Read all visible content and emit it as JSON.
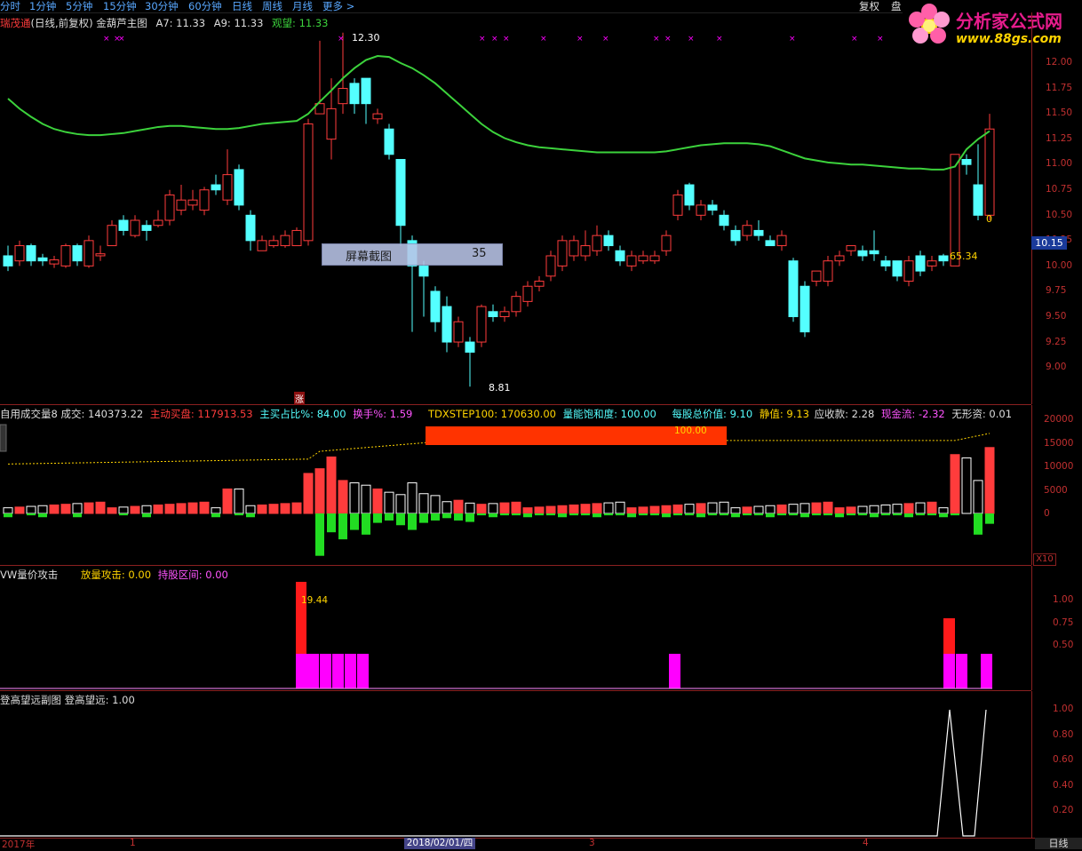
{
  "toolbar": {
    "periods": [
      "分时",
      "1分钟",
      "5分钟",
      "15分钟",
      "30分钟",
      "60分钟",
      "日线",
      "周线",
      "月线",
      "更多 >"
    ],
    "restore_button": "复权",
    "panel_button": "盘"
  },
  "logo": {
    "name": "分析家公式网",
    "url": "www.88gs.com"
  },
  "main_legend": {
    "stock": "瑞茂通",
    "mode": "(日线,前复权)",
    "indicator": "金葫芦主图",
    "a7": "A7: 11.33",
    "a9": "A9: 11.33",
    "watch": "观望: 11.33"
  },
  "price_axis": [
    "12.00",
    "11.75",
    "11.50",
    "11.25",
    "11.00",
    "10.75",
    "10.50",
    "10.25",
    "10.00",
    "9.75",
    "9.50",
    "9.25",
    "9.00"
  ],
  "current_price": "10.15",
  "annotations": {
    "high": "12.30",
    "low": "8.81",
    "right_val": "0",
    "ma_val": "65.34",
    "rise_mark": "涨"
  },
  "screenshot_overlay": {
    "label": "屏幕截图",
    "value": "35"
  },
  "volume_legend": {
    "name": "自用成交量8",
    "vol": "成交: 140373.22",
    "active_buy": "主动买盘: 117913.53",
    "buy_ratio": "主买占比%: 84.00",
    "turnover": "换手%: 1.59",
    "tdx": "TDXSTEP100: 170630.00",
    "saturation": "量能饱和度: 100.00",
    "nav": "每股总价值: 9.10",
    "static": "静值: 9.13",
    "receivable": "应收款: 2.28",
    "cash": "现金流: -2.32",
    "intangible": "无形资: 0.01"
  },
  "volume_axis": [
    "20000",
    "15000",
    "10000",
    "5000",
    "0"
  ],
  "volume_box_label": "100.00",
  "volume_unit": "X10",
  "attack_legend": {
    "name": "VW量价攻击",
    "attack": "放量攻击: 0.00",
    "hold": "持股区间: 0.00"
  },
  "attack_axis": [
    "1.00",
    "0.75",
    "0.50"
  ],
  "attack_label": "19.44",
  "climb_legend": {
    "name": "登高望远副图",
    "value": "登高望远: 1.00"
  },
  "climb_axis": [
    "1.00",
    "0.80",
    "0.60",
    "0.40",
    "0.20"
  ],
  "dates": {
    "year": "2017年",
    "m1": "1",
    "highlight": "2018/02/01/四",
    "m3": "3",
    "m4": "4"
  },
  "period_label": "日线",
  "colors": {
    "up": "#ff3c3c",
    "down": "#54ffff",
    "ma": "#3cd23c",
    "axis": "#c23030",
    "magenta": "#ff00ff"
  }
}
